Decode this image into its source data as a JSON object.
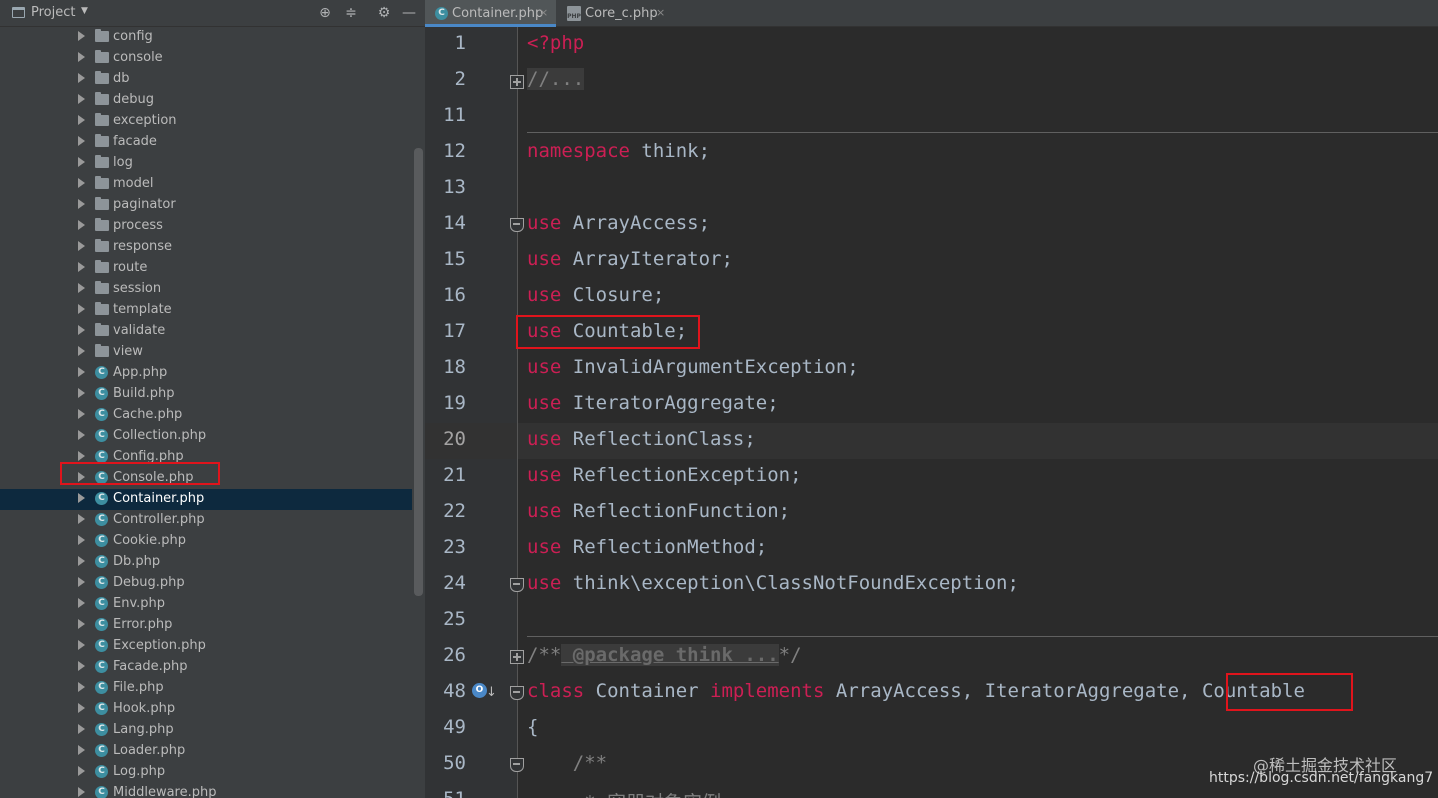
{
  "project_panel": {
    "title": "Project",
    "tree_items": [
      {
        "label": "config",
        "type": "folder"
      },
      {
        "label": "console",
        "type": "folder"
      },
      {
        "label": "db",
        "type": "folder"
      },
      {
        "label": "debug",
        "type": "folder"
      },
      {
        "label": "exception",
        "type": "folder"
      },
      {
        "label": "facade",
        "type": "folder"
      },
      {
        "label": "log",
        "type": "folder"
      },
      {
        "label": "model",
        "type": "folder"
      },
      {
        "label": "paginator",
        "type": "folder"
      },
      {
        "label": "process",
        "type": "folder"
      },
      {
        "label": "response",
        "type": "folder"
      },
      {
        "label": "route",
        "type": "folder"
      },
      {
        "label": "session",
        "type": "folder"
      },
      {
        "label": "template",
        "type": "folder"
      },
      {
        "label": "validate",
        "type": "folder"
      },
      {
        "label": "view",
        "type": "folder"
      },
      {
        "label": "App.php",
        "type": "class"
      },
      {
        "label": "Build.php",
        "type": "class"
      },
      {
        "label": "Cache.php",
        "type": "class"
      },
      {
        "label": "Collection.php",
        "type": "class"
      },
      {
        "label": "Config.php",
        "type": "class"
      },
      {
        "label": "Console.php",
        "type": "class"
      },
      {
        "label": "Container.php",
        "type": "class",
        "selected": true
      },
      {
        "label": "Controller.php",
        "type": "class"
      },
      {
        "label": "Cookie.php",
        "type": "class"
      },
      {
        "label": "Db.php",
        "type": "class"
      },
      {
        "label": "Debug.php",
        "type": "class"
      },
      {
        "label": "Env.php",
        "type": "class"
      },
      {
        "label": "Error.php",
        "type": "class"
      },
      {
        "label": "Exception.php",
        "type": "class"
      },
      {
        "label": "Facade.php",
        "type": "class"
      },
      {
        "label": "File.php",
        "type": "class"
      },
      {
        "label": "Hook.php",
        "type": "class"
      },
      {
        "label": "Lang.php",
        "type": "class"
      },
      {
        "label": "Loader.php",
        "type": "class"
      },
      {
        "label": "Log.php",
        "type": "class"
      },
      {
        "label": "Middleware.php",
        "type": "class"
      }
    ]
  },
  "tabs": [
    {
      "label": "Container.php",
      "close": "×",
      "active": true
    },
    {
      "label": "Core_c.php",
      "close": "×",
      "active": false
    }
  ],
  "editor": {
    "lines": [
      {
        "num": "1",
        "tokens": [
          {
            "t": "<?php",
            "c": "kw"
          }
        ]
      },
      {
        "num": "2",
        "tokens": [
          {
            "t": "//...",
            "c": "fold"
          }
        ]
      },
      {
        "num": "11",
        "tokens": []
      },
      {
        "num": "12",
        "tokens": [
          {
            "t": "namespace",
            "c": "kw"
          },
          {
            "t": " think;",
            "c": "plain"
          }
        ]
      },
      {
        "num": "13",
        "tokens": []
      },
      {
        "num": "14",
        "tokens": [
          {
            "t": "use",
            "c": "kw"
          },
          {
            "t": " ArrayAccess;",
            "c": "plain"
          }
        ]
      },
      {
        "num": "15",
        "tokens": [
          {
            "t": "use",
            "c": "kw"
          },
          {
            "t": " ArrayIterator;",
            "c": "plain"
          }
        ]
      },
      {
        "num": "16",
        "tokens": [
          {
            "t": "use",
            "c": "kw"
          },
          {
            "t": " Closure;",
            "c": "plain"
          }
        ]
      },
      {
        "num": "17",
        "tokens": [
          {
            "t": "use",
            "c": "kw"
          },
          {
            "t": " Countable;",
            "c": "plain"
          }
        ]
      },
      {
        "num": "18",
        "tokens": [
          {
            "t": "use",
            "c": "kw"
          },
          {
            "t": " InvalidArgumentException;",
            "c": "plain"
          }
        ]
      },
      {
        "num": "19",
        "tokens": [
          {
            "t": "use",
            "c": "kw"
          },
          {
            "t": " IteratorAggregate;",
            "c": "plain"
          }
        ]
      },
      {
        "num": "20",
        "tokens": [
          {
            "t": "use",
            "c": "kw"
          },
          {
            "t": " ReflectionClass;",
            "c": "plain"
          }
        ]
      },
      {
        "num": "21",
        "tokens": [
          {
            "t": "use",
            "c": "kw"
          },
          {
            "t": " ReflectionException;",
            "c": "plain"
          }
        ]
      },
      {
        "num": "22",
        "tokens": [
          {
            "t": "use",
            "c": "kw"
          },
          {
            "t": " ReflectionFunction;",
            "c": "plain"
          }
        ]
      },
      {
        "num": "23",
        "tokens": [
          {
            "t": "use",
            "c": "kw"
          },
          {
            "t": " ReflectionMethod;",
            "c": "plain"
          }
        ]
      },
      {
        "num": "24",
        "tokens": [
          {
            "t": "use",
            "c": "kw"
          },
          {
            "t": " think\\exception\\ClassNotFoundException;",
            "c": "plain"
          }
        ]
      },
      {
        "num": "25",
        "tokens": []
      },
      {
        "num": "26",
        "tokens": [
          {
            "t": "/**",
            "c": "cmt"
          },
          {
            "t": " @package think ...",
            "c": "doc"
          },
          {
            "t": "*/",
            "c": "cmt"
          }
        ]
      },
      {
        "num": "48",
        "tokens": [
          {
            "t": "class",
            "c": "kw"
          },
          {
            "t": " Container ",
            "c": "plain"
          },
          {
            "t": "implements",
            "c": "kw"
          },
          {
            "t": " ArrayAccess, IteratorAggregate, ",
            "c": "plain"
          },
          {
            "t": "Countable",
            "c": "plain"
          }
        ]
      },
      {
        "num": "49",
        "tokens": [
          {
            "t": "{",
            "c": "plain"
          }
        ]
      },
      {
        "num": "50",
        "tokens": [
          {
            "t": "    /**",
            "c": "cmt"
          }
        ]
      },
      {
        "num": "51",
        "tokens": [
          {
            "t": "     * 容器对象实例",
            "c": "cmt"
          }
        ]
      }
    ],
    "current_line": "20"
  },
  "watermark": {
    "top": "@稀土掘金技术社区",
    "bottom": "https://blog.csdn.net/fangkang7"
  }
}
